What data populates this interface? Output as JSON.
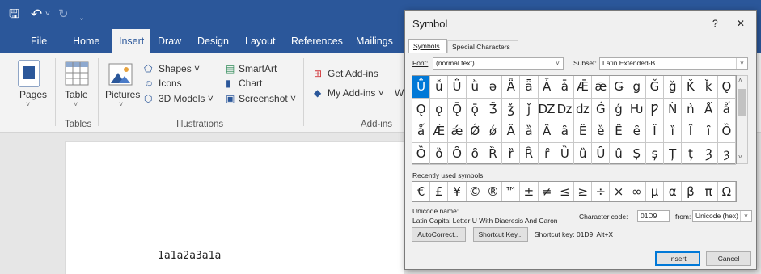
{
  "quick_access": {
    "save": "🖫",
    "undo": "↶",
    "undo_dropdown": "˅",
    "redo": "↻",
    "customize": "ˬ"
  },
  "tabs": [
    {
      "label": "File",
      "active": false
    },
    {
      "label": "Home",
      "active": false
    },
    {
      "label": "Insert",
      "active": true
    },
    {
      "label": "Draw",
      "active": false
    },
    {
      "label": "Design",
      "active": false
    },
    {
      "label": "Layout",
      "active": false
    },
    {
      "label": "References",
      "active": false
    },
    {
      "label": "Mailings",
      "active": false
    }
  ],
  "ribbon": {
    "pages_label": "Pages",
    "table_label": "Table",
    "tables_group": "Tables",
    "pictures_label": "Pictures",
    "shapes_label": "Shapes ˅",
    "icons_label": "Icons",
    "models_label": "3D Models ˅",
    "smartart_label": "SmartArt",
    "chart_label": "Chart",
    "screenshot_label": "Screenshot ˅",
    "illustrations_group": "Illustrations",
    "get_addins_label": "Get Add-ins",
    "my_addins_label": "My Add-ins ˅",
    "addins_group": "Add-ins",
    "w_fragment": "W"
  },
  "document": {
    "text": "1a1a2a3a1a"
  },
  "dialog": {
    "title": "Symbol",
    "help": "?",
    "close": "✕",
    "tabs": [
      "Symbols",
      "Special Characters"
    ],
    "font_label": "Font:",
    "font_value": "(normal text)",
    "subset_label": "Subset:",
    "subset_value": "Latin Extended-B",
    "symbols": [
      [
        "Ǚ",
        "ǚ",
        "Ǜ",
        "ǜ",
        "ǝ",
        "Ǟ",
        "ǟ",
        "Ǡ",
        "ǡ",
        "Ǣ",
        "ǣ",
        "Ǥ",
        "ǥ",
        "Ǧ",
        "ǧ",
        "Ǩ",
        "ǩ",
        "Ǫ"
      ],
      [
        "Ǫ",
        "ǫ",
        "Ǭ",
        "ǭ",
        "Ǯ",
        "ǯ",
        "ǰ",
        "Ǳ",
        "ǲ",
        "ǳ",
        "Ǵ",
        "ǵ",
        "Ƕ",
        "Ƿ",
        "Ǹ",
        "ǹ",
        "Ǻ",
        "ǻ"
      ],
      [
        "ǻ",
        "Ǽ",
        "ǽ",
        "Ǿ",
        "ǿ",
        "Ȁ",
        "ȁ",
        "Ȃ",
        "ȃ",
        "Ȅ",
        "ȅ",
        "Ȇ",
        "ȇ",
        "Ȉ",
        "ȉ",
        "Ȋ",
        "ȋ",
        "Ȍ"
      ],
      [
        "Ȍ",
        "ȍ",
        "Ȏ",
        "ȏ",
        "Ȑ",
        "ȑ",
        "Ȓ",
        "ȓ",
        "Ȕ",
        "ȕ",
        "Ȗ",
        "ȗ",
        "Ș",
        "ș",
        "Ț",
        "ț",
        "Ȝ",
        "ȝ"
      ]
    ],
    "selected_symbol": "Ǚ",
    "recent_label": "Recently used symbols:",
    "recent_symbols": [
      "€",
      "£",
      "¥",
      "©",
      "®",
      "™",
      "±",
      "≠",
      "≤",
      "≥",
      "÷",
      "×",
      "∞",
      "µ",
      "α",
      "β",
      "π",
      "Ω"
    ],
    "unicode_name_label": "Unicode name:",
    "unicode_name_value": "Latin Capital Letter U With Diaeresis And Caron",
    "char_code_label": "Character code:",
    "char_code_value": "01D9",
    "from_label": "from:",
    "from_value": "Unicode (hex)",
    "autocorrect_label": "AutoCorrect...",
    "shortcut_key_button": "Shortcut Key...",
    "shortcut_text": "Shortcut key: 01D9, Alt+X",
    "insert_label": "Insert",
    "cancel_label": "Cancel"
  }
}
